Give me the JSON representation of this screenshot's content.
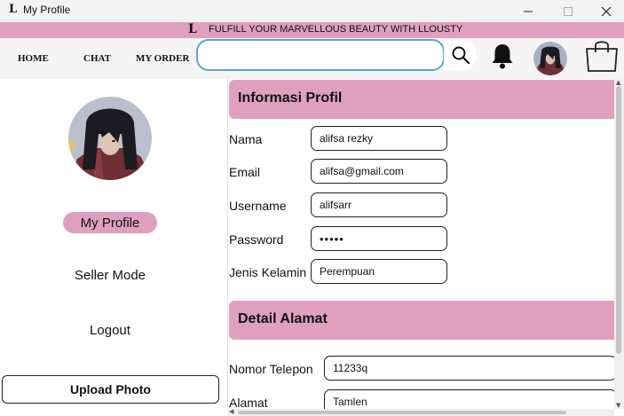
{
  "window": {
    "title": "My Profile",
    "logo": "L"
  },
  "banner": {
    "logo": "L",
    "tagline": "FULFILL YOUR MARVELLOUS BEAUTY WITH LLOUSTY"
  },
  "nav": {
    "home": "HOME",
    "chat": "CHAT",
    "order": "MY ORDER",
    "search_value": "",
    "icons": [
      "search-icon",
      "bell-icon",
      "avatar",
      "cart-icon"
    ]
  },
  "sidebar": {
    "menu": {
      "profile": "My Profile",
      "seller": "Seller Mode",
      "logout": "Logout"
    },
    "upload_label": "Upload Photo"
  },
  "profile": {
    "heading": "Informasi Profil",
    "fields": [
      {
        "label": "Nama",
        "value": "alifsa rezky"
      },
      {
        "label": "Email",
        "value": "alifsa@gmail.com"
      },
      {
        "label": "Username",
        "value": "alifsarr"
      },
      {
        "label": "Password",
        "value": "•••••"
      },
      {
        "label": "Jenis Kelamin",
        "value": "Perempuan"
      }
    ]
  },
  "address": {
    "heading": "Detail Alamat",
    "fields": [
      {
        "label": "Nomor Telepon",
        "value": "11233q"
      },
      {
        "label": "Alamat",
        "value": "Tamlen"
      }
    ]
  },
  "colors": {
    "accent_pink": "#dfa0bf",
    "search_border": "#5fa7c9"
  }
}
